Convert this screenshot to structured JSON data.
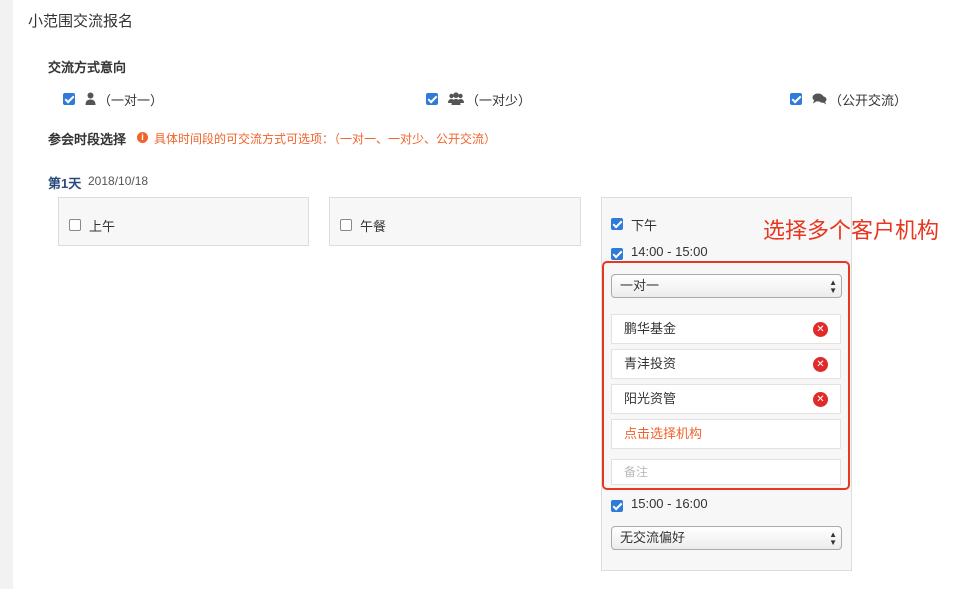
{
  "page": {
    "title": "小范围交流报名"
  },
  "exchange_mode": {
    "label": "交流方式意向",
    "options": [
      {
        "icon": "user-icon",
        "text": "（一对一）",
        "checked": true
      },
      {
        "icon": "users-icon",
        "text": "（一对少）",
        "checked": true
      },
      {
        "icon": "comments-icon",
        "text": "（公开交流）",
        "checked": true
      }
    ]
  },
  "session_select": {
    "label": "参会时段选择",
    "hint_icon": "info-icon",
    "hint": "具体时间段的可交流方式可选项：（一对一、一对少、公开交流）"
  },
  "day1": {
    "label": "第1天",
    "date": "2018/10/18",
    "periods": {
      "morning": {
        "label": "上午",
        "checked": false
      },
      "lunch": {
        "label": "午餐",
        "checked": false
      },
      "afternoon": {
        "label": "下午",
        "checked": true,
        "slots": [
          {
            "time": "14:00 - 15:00",
            "checked": true,
            "mode": "一对一",
            "orgs": [
              "鹏华基金",
              "青沣投资",
              "阳光资管"
            ],
            "pick_label": "点击选择机构",
            "note_placeholder": "备注"
          },
          {
            "time": "15:00 - 16:00",
            "checked": true,
            "preference": "无交流偏好"
          }
        ]
      }
    }
  },
  "annotation": "选择多个客户机构",
  "colors": {
    "accent": "#2f7bd9",
    "hint": "#f0632a",
    "highlight": "#e8361f",
    "remove": "#e02b2b"
  }
}
